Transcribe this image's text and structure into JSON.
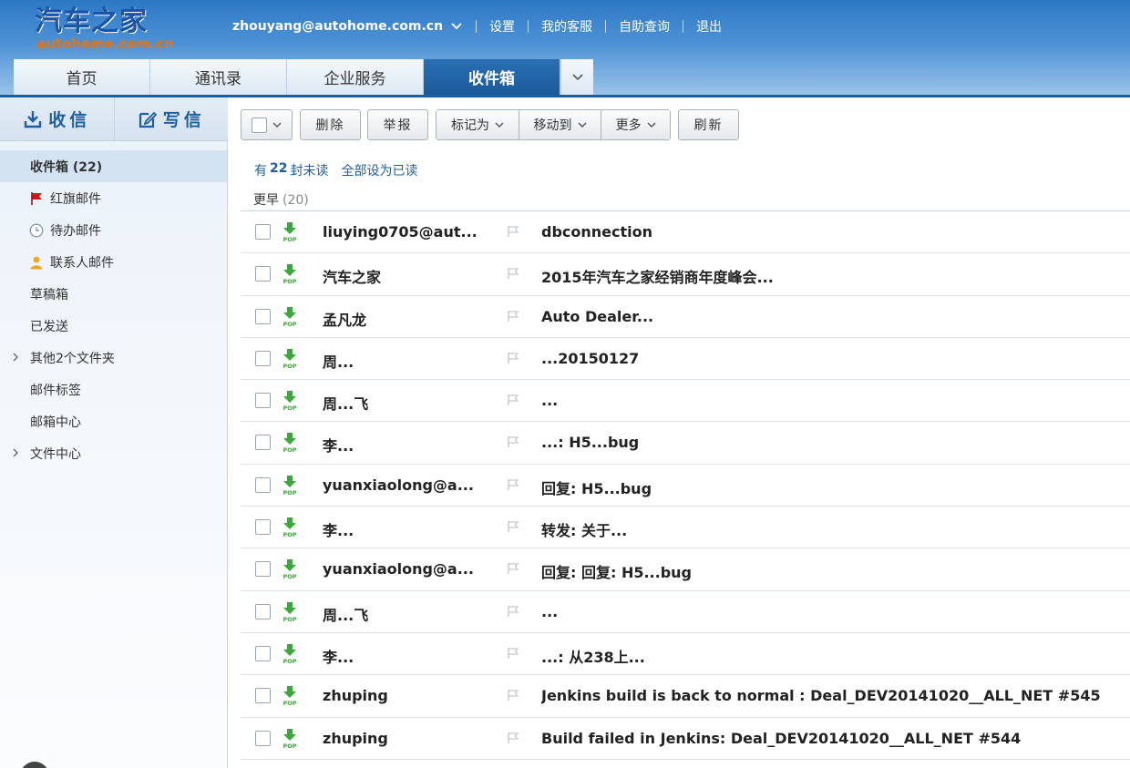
{
  "header": {
    "logo_main": "汽车之家",
    "logo_sub": "autohome.com.cn",
    "email": "zhouyang@autohome.com.cn",
    "links": [
      "设置",
      "我的客服",
      "自助查询",
      "退出"
    ]
  },
  "tabs": [
    {
      "label": "首页",
      "active": false
    },
    {
      "label": "通讯录",
      "active": false
    },
    {
      "label": "企业服务",
      "active": false
    },
    {
      "label": "收件箱",
      "active": true
    }
  ],
  "sidebar": {
    "receive_label": "收信",
    "compose_label": "写信",
    "folders": [
      {
        "label": "收件箱 (22)",
        "icon": "",
        "active": true
      },
      {
        "label": "红旗邮件",
        "icon": "red-flag-icon"
      },
      {
        "label": "待办邮件",
        "icon": "clock-icon"
      },
      {
        "label": "联系人邮件",
        "icon": "person-icon"
      },
      {
        "label": "草稿箱",
        "icon": ""
      },
      {
        "label": "已发送",
        "icon": ""
      },
      {
        "label": "其他2个文件夹",
        "icon": "",
        "expandable": true
      },
      {
        "label": "邮件标签",
        "icon": ""
      },
      {
        "label": "邮箱中心",
        "icon": ""
      },
      {
        "label": "文件中心",
        "icon": "",
        "expandable": true
      }
    ]
  },
  "toolbar": {
    "delete_label": "删除",
    "report_label": "举报",
    "mark_as_label": "标记为",
    "move_to_label": "移动到",
    "more_label": "更多",
    "refresh_label": "刷新"
  },
  "summary": {
    "prefix": "有",
    "count": "22",
    "suffix": "封未读",
    "mark_all_read": "全部设为已读"
  },
  "group": {
    "label": "更早",
    "count": "(20)"
  },
  "mails": [
    {
      "sender": "liuying0705@aut...",
      "subject": "dbconnection"
    },
    {
      "sender": "汽车之家",
      "subject": "2015年汽车之家经销商年度峰会..."
    },
    {
      "sender": "孟凡龙",
      "subject": "Auto Dealer..."
    },
    {
      "sender": "周...",
      "subject": "...20150127"
    },
    {
      "sender": "周...飞",
      "subject": "..."
    },
    {
      "sender": "李...",
      "subject": "...: H5...bug"
    },
    {
      "sender": "yuanxiaolong@a...",
      "subject": "回复: H5...bug"
    },
    {
      "sender": "李...",
      "subject": "转发: 关于..."
    },
    {
      "sender": "yuanxiaolong@a...",
      "subject": "回复: 回复: H5...bug"
    },
    {
      "sender": "周...飞",
      "subject": "..."
    },
    {
      "sender": "李...",
      "subject": "...: 从238上..."
    },
    {
      "sender": "zhuping",
      "subject": "Jenkins build is back to normal : Deal_DEV20141020__ALL_NET #545"
    },
    {
      "sender": "zhuping",
      "subject": "Build failed in Jenkins: Deal_DEV20141020__ALL_NET #544"
    }
  ],
  "colors": {
    "accent": "#1f5f9f",
    "pop_icon": "#3aa83a",
    "red_flag": "#d0161b"
  }
}
